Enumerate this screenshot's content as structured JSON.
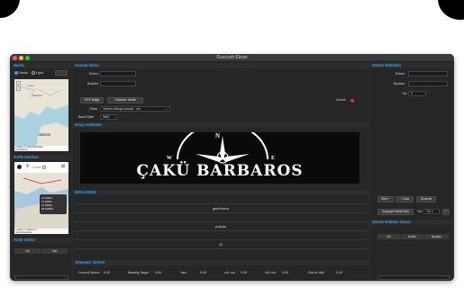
{
  "app": {
    "title": "Gozcuzh Ekran"
  },
  "colors": {
    "accent": "#3aa0ff",
    "status_red": "#e23636",
    "background": "#262626"
  },
  "left": {
    "map_header": "Harita",
    "radio_uydu": "Harita",
    "radio_street": "Uydu",
    "map_labels": [
      "Leaflet | © OpenStreetMap",
      "contributors"
    ],
    "map_names": [
      "Lyson",
      "Bulgaria",
      "TÜRKİYE"
    ],
    "traffic_header": "Trafik Haritası",
    "traffic_search": "Search 🔲",
    "traffic_tooltip": [
      "41.51603",
      "27.20521",
      "41.02849",
      "28.810584"
    ],
    "traffic_credit": [
      "Leaflet | © Mapbox ©",
      "OpenStreetMap"
    ],
    "alarm_header": "Anlık Veriler",
    "alarm_cols": [
      "No",
      "Veri"
    ]
  },
  "center": {
    "manual_header": "Konum Verisi",
    "lat_label": "Enlem",
    "lon_label": "Boylam",
    "gps_button": "GPS Bağla",
    "port_button": "Cihazları Yenile",
    "device_label": "Cihaz",
    "device_value": "/dev/cu.debug-console - n/a",
    "baud_label": "Baud Rate",
    "baud_value": "9600",
    "status_label": "Durum",
    "camera_header": "Grup Ambleme",
    "banner_title": "ÇAKÜ BARBAROS",
    "compass_letters": [
      "N",
      "W",
      "E",
      "S"
    ],
    "commands_header": "İNFLUXDEX",
    "commands": [
      "gerei konu",
      "pukola",
      "10"
    ],
    "telemetry_header": "Telemetri Verileri",
    "telemetry": [
      {
        "label": "Ground Speed",
        "value": "0.00"
      },
      {
        "label": "Bearing Target",
        "value": "0.00"
      },
      {
        "label": "Yaw",
        "value": "0.00"
      },
      {
        "label": "ch1 out",
        "value": "0.00"
      },
      {
        "label": "ch2 out",
        "value": "0.00"
      },
      {
        "label": "Dist to NAV",
        "value": "0.00"
      }
    ]
  },
  "right": {
    "waypoint_header": "Gönüv Noktaları",
    "lat_label": "Enlem",
    "lon_label": "Boylam",
    "no_label": "No",
    "no_value": "0",
    "btn_add": "Ekle +",
    "btn_remove": "− Çıkar",
    "btn_edit": "Düzenle",
    "btn_send": "Dosyaya Verisi Ekle",
    "tur_label": "Tür",
    "tur_value": "Tür 1",
    "plus": "+",
    "table_header": "Gönüv Noktası Girası",
    "cols": [
      "No",
      "Enlem",
      "Boylam"
    ]
  }
}
